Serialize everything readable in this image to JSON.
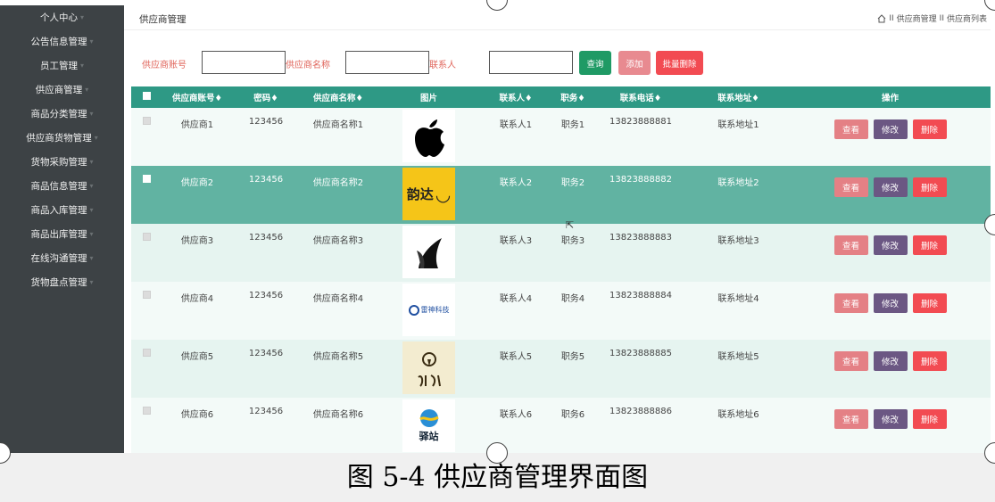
{
  "sidebar": {
    "items": [
      {
        "label": "个人中心"
      },
      {
        "label": "公告信息管理"
      },
      {
        "label": "员工管理"
      },
      {
        "label": "供应商管理"
      },
      {
        "label": "商品分类管理"
      },
      {
        "label": "供应商货物管理"
      },
      {
        "label": "货物采购管理"
      },
      {
        "label": "商品信息管理"
      },
      {
        "label": "商品入库管理"
      },
      {
        "label": "商品出库管理"
      },
      {
        "label": "在线沟通管理"
      },
      {
        "label": "货物盘点管理"
      }
    ],
    "arrow_icon": "chevron-down-icon"
  },
  "header": {
    "title": "供应商管理",
    "breadcrumb": [
      "供应商管理",
      "供应商列表"
    ],
    "separator": "II"
  },
  "search": {
    "account_label": "供应商账号",
    "account_value": "",
    "name_label": "供应商名称",
    "name_value": "",
    "contact_label": "联系人",
    "contact_value": "",
    "query_button": "查询",
    "add_button": "添加",
    "batch_delete_button": "批量删除"
  },
  "table": {
    "columns": [
      "供应商账号",
      "密码",
      "供应商名称",
      "图片",
      "联系人",
      "职务",
      "联系电话",
      "联系地址",
      "操作"
    ],
    "sortable_marker": "♦",
    "rows": [
      {
        "account": "供应商1",
        "password": "123456",
        "name": "供应商名称1",
        "logo": "apple-logo",
        "contact": "联系人1",
        "duty": "职务1",
        "phone": "13823888881",
        "address": "联系地址1"
      },
      {
        "account": "供应商2",
        "password": "123456",
        "name": "供应商名称2",
        "logo": "yunda-logo",
        "logo_text": "韵达",
        "contact": "联系人2",
        "duty": "职务2",
        "phone": "13823888882",
        "address": "联系地址2",
        "selected": true
      },
      {
        "account": "供应商3",
        "password": "123456",
        "name": "供应商名称3",
        "logo": "dark-brand-logo",
        "contact": "联系人3",
        "duty": "职务3",
        "phone": "13823888883",
        "address": "联系地址3"
      },
      {
        "account": "供应商4",
        "password": "123456",
        "name": "供应商名称4",
        "logo": "tech-company-logo",
        "logo_text": "雷神科技",
        "contact": "联系人4",
        "duty": "职务4",
        "phone": "13823888884",
        "address": "联系地址4"
      },
      {
        "account": "供应商5",
        "password": "123456",
        "name": "供应商名称5",
        "logo": "calligraphy-logo",
        "contact": "联系人5",
        "duty": "职务5",
        "phone": "13823888885",
        "address": "联系地址5"
      },
      {
        "account": "供应商6",
        "password": "123456",
        "name": "供应商名称6",
        "logo": "wave-logo",
        "logo_text": "驿站",
        "contact": "联系人6",
        "duty": "职务6",
        "phone": "13823888886",
        "address": "联系地址6"
      }
    ],
    "actions": {
      "view": "查看",
      "edit": "修改",
      "delete": "删除"
    }
  },
  "caption": "图 5-4 供应商管理界面图",
  "colors": {
    "sidebar_bg": "#3d4245",
    "table_header": "#2e9985",
    "row_selected": "#61b3a2",
    "query_btn": "#1f9a65",
    "add_btn": "#e88a90",
    "batch_delete_btn": "#f24b52",
    "view_btn": "#e48085",
    "edit_btn": "#6b5783",
    "delete_btn": "#f24b52",
    "label_color": "#e0645a"
  }
}
